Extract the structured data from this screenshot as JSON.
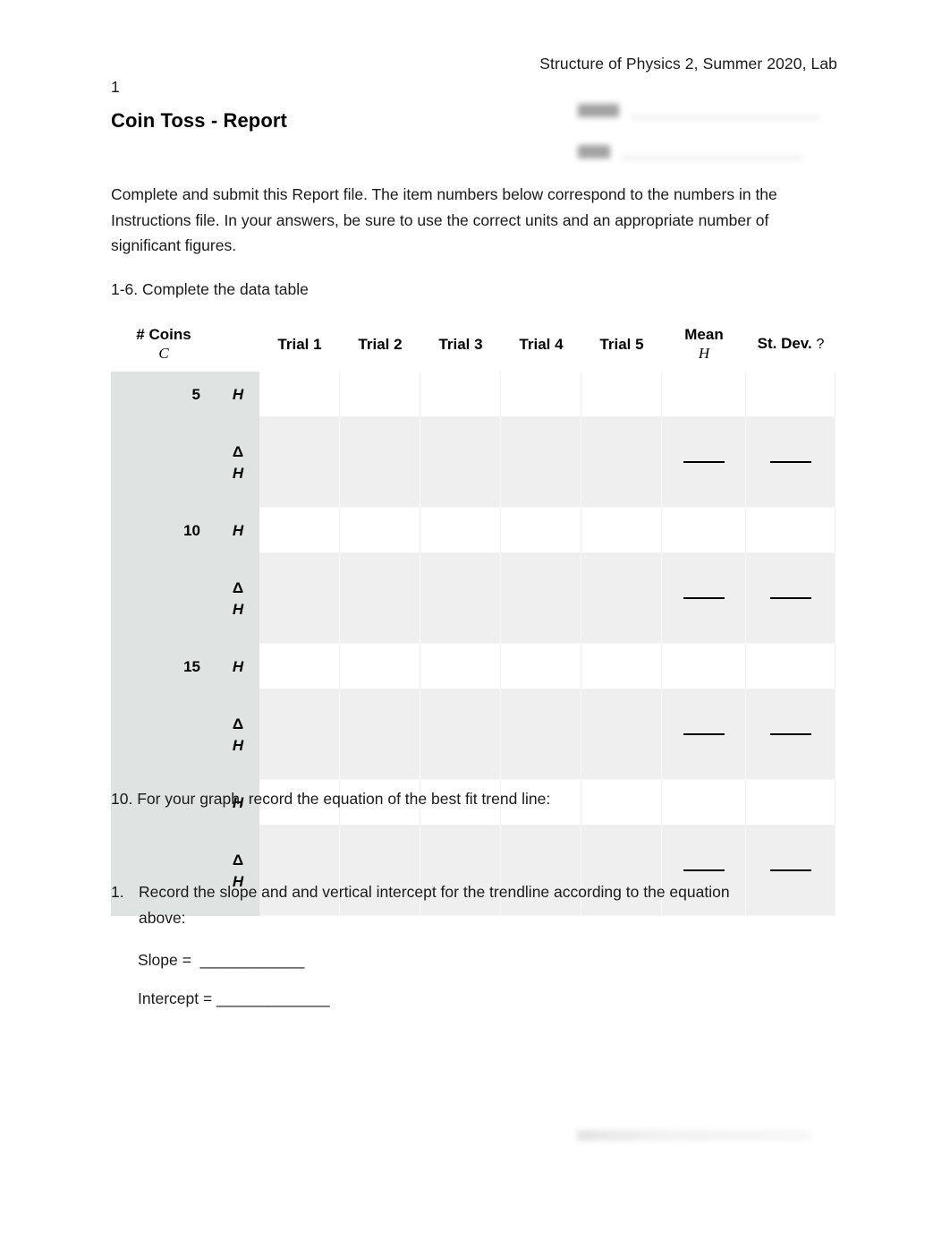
{
  "document": {
    "header_line1": "Structure of Physics 2, Summer 2020, Lab",
    "header_line2": "1",
    "title": "Coin Toss - Report",
    "intro_paragraph": "Complete and submit this Report file.  The item numbers below correspond to the numbers in the Instructions file. In your answers, be sure to use the correct units and an appropriate number of significant figures.",
    "item_1_6": "1-6. Complete the data table"
  },
  "name_date_block": {
    "redacted": true,
    "field_1_label": "Name:",
    "field_2_label": "Date:"
  },
  "data_table": {
    "headers": {
      "coins": "# Coins",
      "coins_symbol": "C",
      "trial_1": "Trial 1",
      "trial_2": "Trial 2",
      "trial_3": "Trial 3",
      "trial_4": "Trial 4",
      "trial_5": "Trial 5",
      "mean": "Mean",
      "mean_symbol": "H",
      "st_dev": "St. Dev.",
      "st_dev_symbol": "?"
    },
    "rows": [
      {
        "coins": "5",
        "symbol_kind": "H",
        "symbol_delta": "",
        "symbol_letter": "H",
        "trials": [
          "",
          "",
          "",
          "",
          ""
        ],
        "mean": "",
        "st_dev": "",
        "mean_na": false,
        "st_dev_na": false
      },
      {
        "coins": "",
        "symbol_kind": "dH",
        "symbol_delta": "Δ",
        "symbol_letter": "H",
        "trials": [
          "",
          "",
          "",
          "",
          ""
        ],
        "mean": "",
        "st_dev": "",
        "mean_na": true,
        "st_dev_na": true
      },
      {
        "coins": "10",
        "symbol_kind": "H",
        "symbol_delta": "",
        "symbol_letter": "H",
        "trials": [
          "",
          "",
          "",
          "",
          ""
        ],
        "mean": "",
        "st_dev": "",
        "mean_na": false,
        "st_dev_na": false
      },
      {
        "coins": "",
        "symbol_kind": "dH",
        "symbol_delta": "Δ",
        "symbol_letter": "H",
        "trials": [
          "",
          "",
          "",
          "",
          ""
        ],
        "mean": "",
        "st_dev": "",
        "mean_na": true,
        "st_dev_na": true
      },
      {
        "coins": "15",
        "symbol_kind": "H",
        "symbol_delta": "",
        "symbol_letter": "H",
        "trials": [
          "",
          "",
          "",
          "",
          ""
        ],
        "mean": "",
        "st_dev": "",
        "mean_na": false,
        "st_dev_na": false
      },
      {
        "coins": "",
        "symbol_kind": "dH",
        "symbol_delta": "Δ",
        "symbol_letter": "H",
        "trials": [
          "",
          "",
          "",
          "",
          ""
        ],
        "mean": "",
        "st_dev": "",
        "mean_na": true,
        "st_dev_na": true
      },
      {
        "coins": "",
        "symbol_kind": "H",
        "symbol_delta": "",
        "symbol_letter": "H",
        "trials": [
          "",
          "",
          "",
          "",
          ""
        ],
        "mean": "",
        "st_dev": "",
        "mean_na": false,
        "st_dev_na": false
      },
      {
        "coins": "",
        "symbol_kind": "dH",
        "symbol_delta": "Δ",
        "symbol_letter": "H",
        "trials": [
          "",
          "",
          "",
          "",
          ""
        ],
        "mean": "",
        "st_dev": "",
        "mean_na": true,
        "st_dev_na": true
      }
    ]
  },
  "questions": {
    "item_10": "10. For your graph, record the equation of the best fit trend line:",
    "item_1_number": "1.",
    "item_1_text": "Record the slope and and vertical intercept for the trendline according to the equation above:",
    "slope_label": "Slope =  ____________",
    "intercept_label": "Intercept = _____________"
  },
  "colors": {
    "page_background": "#ffffff",
    "text": "#1a1a1a",
    "table_label_background": "#dfe4e3",
    "table_h_cell_background": "#ffffff",
    "table_dh_cell_background": "#efefef",
    "rule": "#000000"
  }
}
